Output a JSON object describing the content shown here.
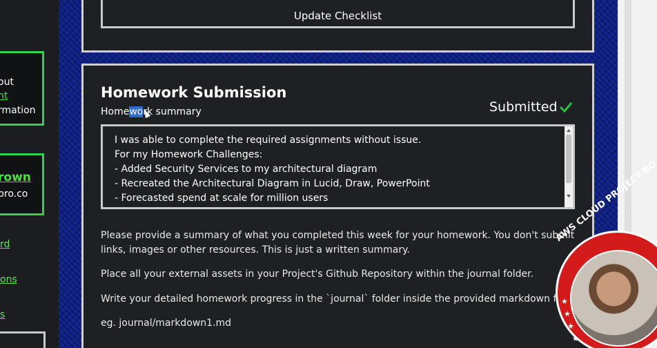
{
  "left_panel": {
    "box1_lines": [
      "out",
      "nt",
      "rmation"
    ],
    "box2_lines": [
      "rown",
      "pro.co"
    ],
    "links": [
      "rd",
      "ons",
      "s"
    ]
  },
  "top_card": {
    "button_label": "Update Checklist"
  },
  "homework": {
    "title": "Homework Submission",
    "subtitle_before": "Home",
    "subtitle_selected": "wo",
    "subtitle_after": "rk summary",
    "status": "Submitted",
    "summary_lines": [
      "I was able to complete the required assignments without issue.",
      "For my Homework Challenges:",
      "- Added Security Services to my architectural diagram",
      "- Recreated the Architectural Diagram in Lucid, Draw, PowerPoint",
      "- Forecasted spend at scale for million users"
    ],
    "instructions": [
      "Please provide a summary of what you completed this week for your homework. You don't submit",
      "links, images or other resources. This is just a written summary.",
      "Place all your external assets in your Project's Github Repository within the journal folder.",
      "Write your detailed homework progress in the `journal` folder inside the provided markdown files",
      "eg. journal/markdown1.md"
    ]
  },
  "badge": {
    "text": "AWS CLOUD PROJECT BO"
  },
  "colors": {
    "accent_green": "#2fd24a",
    "background_blue": "#0d1f86",
    "badge_red": "#d41b1b"
  }
}
